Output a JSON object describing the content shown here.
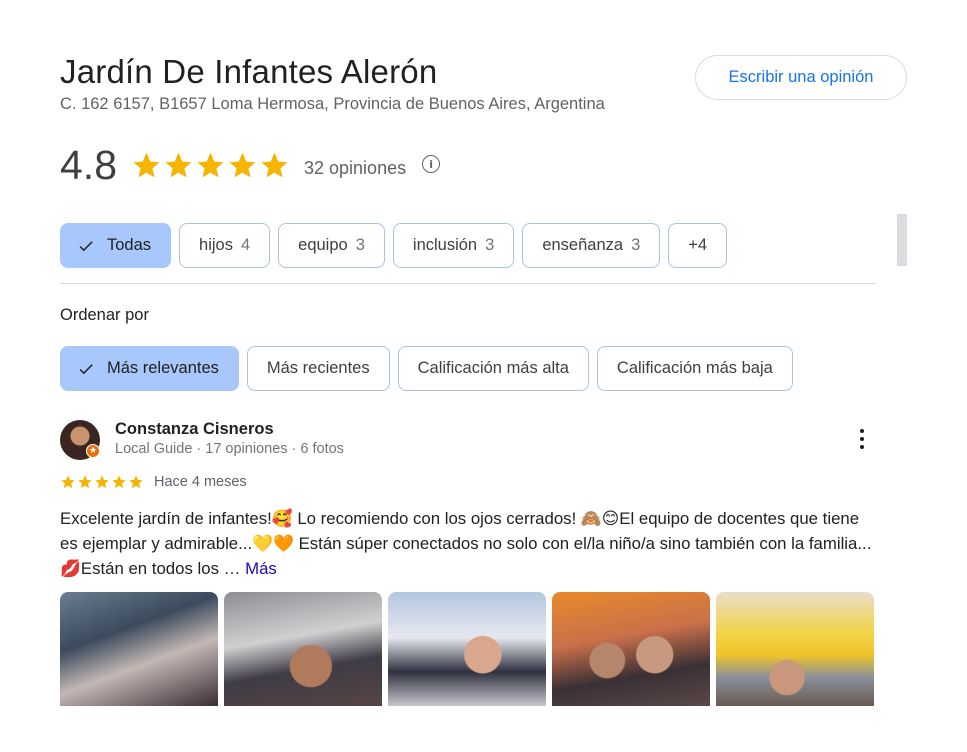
{
  "place": {
    "name": "Jardín De Infantes Alerón",
    "address": "C. 162 6157, B1657 Loma Hermosa, Provincia de Buenos Aires, Argentina"
  },
  "actions": {
    "write_review_label": "Escribir una opinión"
  },
  "rating": {
    "value": "4.8",
    "stars_filled": 5,
    "review_count_label": "32 opiniones",
    "star_color": "#f4b400"
  },
  "topics": [
    {
      "label": "Todas",
      "count": "",
      "selected": true
    },
    {
      "label": "hijos",
      "count": "4",
      "selected": false
    },
    {
      "label": "equipo",
      "count": "3",
      "selected": false
    },
    {
      "label": "inclusión",
      "count": "3",
      "selected": false
    },
    {
      "label": "enseñanza",
      "count": "3",
      "selected": false
    },
    {
      "label": "+4",
      "count": "",
      "selected": false
    }
  ],
  "sort": {
    "label": "Ordenar por",
    "options": [
      {
        "label": "Más relevantes",
        "selected": true
      },
      {
        "label": "Más recientes",
        "selected": false
      },
      {
        "label": "Calificación más alta",
        "selected": false
      },
      {
        "label": "Calificación más baja",
        "selected": false
      }
    ]
  },
  "review": {
    "author": "Constanza Cisneros",
    "meta": "Local Guide · 17 opiniones · 6 fotos",
    "stars": 5,
    "date": "Hace 4 meses",
    "text": "Excelente jardín de infantes!🥰 Lo recomiendo con los ojos cerrados! 🙈😊El equipo de docentes que tiene es ejemplar y admirable...💛🧡 Están súper conectados no solo con el/la niño/a sino también con la familia... 💋Están en todos los …",
    "more_label": "Más",
    "photo_count": 5
  },
  "colors": {
    "accent_blue": "#1a73e8",
    "selected_chip": "#a8c7fa",
    "link": "#1a0dab"
  }
}
